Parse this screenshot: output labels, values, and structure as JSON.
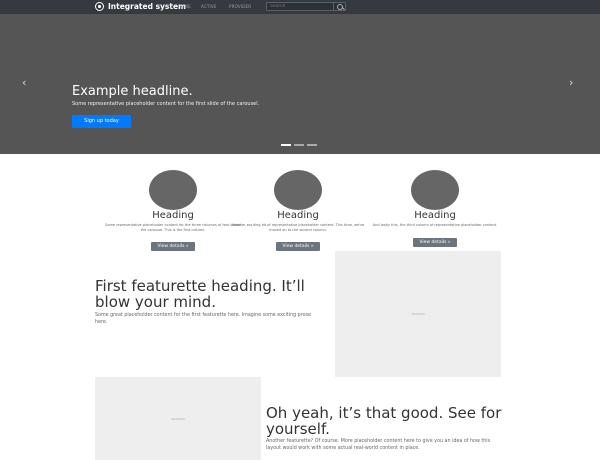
{
  "navbar": {
    "brand": "Integrated system",
    "links": [
      "HOME",
      "ACTIVE",
      "PROVIDER"
    ],
    "search_placeholder": "Search"
  },
  "carousel": {
    "headline": "Example headline.",
    "text": "Some representative placeholder content for the first slide of the carousel.",
    "button": "Sign up today",
    "prev_icon": "‹",
    "next_icon": "›",
    "slide_count": 3,
    "active_slide": 1
  },
  "columns": [
    {
      "heading": "Heading",
      "text": "Some representative placeholder content for the three columns of text below the carousel. This is the first column.",
      "button": "View details »"
    },
    {
      "heading": "Heading",
      "text": "Another exciting bit of representative placeholder content. This time, we've moved on to the second column.",
      "button": "View details »"
    },
    {
      "heading": "Heading",
      "text": "And lastly this, the third column of representative placeholder content.",
      "button": "View details »"
    }
  ],
  "featurettes": [
    {
      "heading": "First featurette heading. It’ll blow your mind.",
      "lead": "Some great placeholder content for the first featurette here. Imagine some exciting prose here.",
      "image_label": "500x500"
    },
    {
      "heading": "Oh yeah, it’s that good. See for yourself.",
      "lead": "Another featurette? Of course. More placeholder content here to give you an idea of how this layout would work with some actual real-world content in place.",
      "image_label": "500x500"
    }
  ],
  "colors": {
    "navbar_bg": "#343a40",
    "carousel_bg": "#555555",
    "primary": "#007bff",
    "secondary": "#6c757d",
    "placeholder": "#eeeeee"
  }
}
